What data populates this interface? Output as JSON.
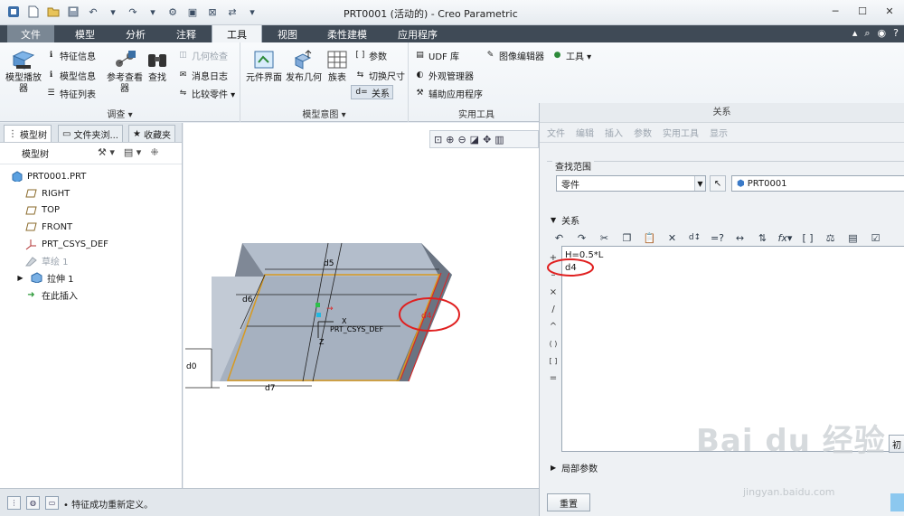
{
  "window": {
    "title": "PRT0001 (活动的) - Creo Parametric"
  },
  "tabs": [
    {
      "label": "文件"
    },
    {
      "label": "模型"
    },
    {
      "label": "分析"
    },
    {
      "label": "注释"
    },
    {
      "label": "工具"
    },
    {
      "label": "视图"
    },
    {
      "label": "柔性建模"
    },
    {
      "label": "应用程序"
    }
  ],
  "ribbon": {
    "investigate": {
      "group_label": "调查 ▾",
      "model_player": "模型播放器",
      "feature_info": "特征信息",
      "model_info": "模型信息",
      "feature_list": "特征列表",
      "reference_viewer": "参考查看器",
      "find": "查找",
      "geometry_check": "几何检查",
      "message_log": "消息日志",
      "compare_part": "比较零件 ▾"
    },
    "model_intent": {
      "group_label": "模型意图 ▾",
      "component_interface": "元件界面",
      "publish_geometry": "发布几何",
      "family_table": "族表",
      "parameters": "参数",
      "switch_dimensions": "切换尺寸",
      "relations": "关系"
    },
    "utilities": {
      "group_label": "实用工具",
      "udf_library": "UDF 库",
      "appearance_manager": "外观管理器",
      "aux_applications": "辅助应用程序",
      "image_editor": "图像编辑器",
      "tools": "工具 ▾"
    }
  },
  "left_panel": {
    "tabs": [
      "模型树",
      "文件夹浏...",
      "收藏夹"
    ],
    "tree_header": "模型树",
    "items": [
      {
        "label": "PRT0001.PRT",
        "icon": "part-icon"
      },
      {
        "label": "RIGHT",
        "icon": "datum-plane-icon"
      },
      {
        "label": "TOP",
        "icon": "datum-plane-icon"
      },
      {
        "label": "FRONT",
        "icon": "datum-plane-icon"
      },
      {
        "label": "PRT_CSYS_DEF",
        "icon": "csys-icon"
      },
      {
        "label": "草绘 1",
        "icon": "sketch-icon"
      },
      {
        "label": "拉伸 1",
        "icon": "extrude-icon"
      },
      {
        "label": "在此插入",
        "icon": "insert-here-icon"
      }
    ]
  },
  "graphics": {
    "dims": {
      "d5": "d5",
      "d6": "d6",
      "d4": "d4",
      "d0": "d0",
      "d7": "d7"
    },
    "csys_label": "PRT_CSYS_DEF",
    "axis_x": "X",
    "axis_z": "Z"
  },
  "status": {
    "message": "• 特征成功重新定义。"
  },
  "dialog": {
    "title": "关系",
    "menu": [
      "文件",
      "编辑",
      "插入",
      "参数",
      "实用工具",
      "显示"
    ],
    "lookin_label": "查找范围",
    "scope_value": "零件",
    "object_value": "PRT0001",
    "relations_label": "关系",
    "operators": [
      "+",
      "–",
      "×",
      "/",
      "^",
      "( )",
      "[ ]",
      "="
    ],
    "relation_lines": [
      "H=0.5*L",
      "d4"
    ],
    "local_params_label": "局部参数",
    "reset_button": "重置",
    "init_button": "初"
  },
  "watermark": {
    "brand": "Bai du 经验",
    "url": "jingyan.baidu.com"
  },
  "colors": {
    "tab_bar": "#3f4a56",
    "highlight_red": "#e02020",
    "edge_orange": "#d89a20",
    "block_top": "#a9b4c3",
    "block_side": "#6e7886"
  }
}
